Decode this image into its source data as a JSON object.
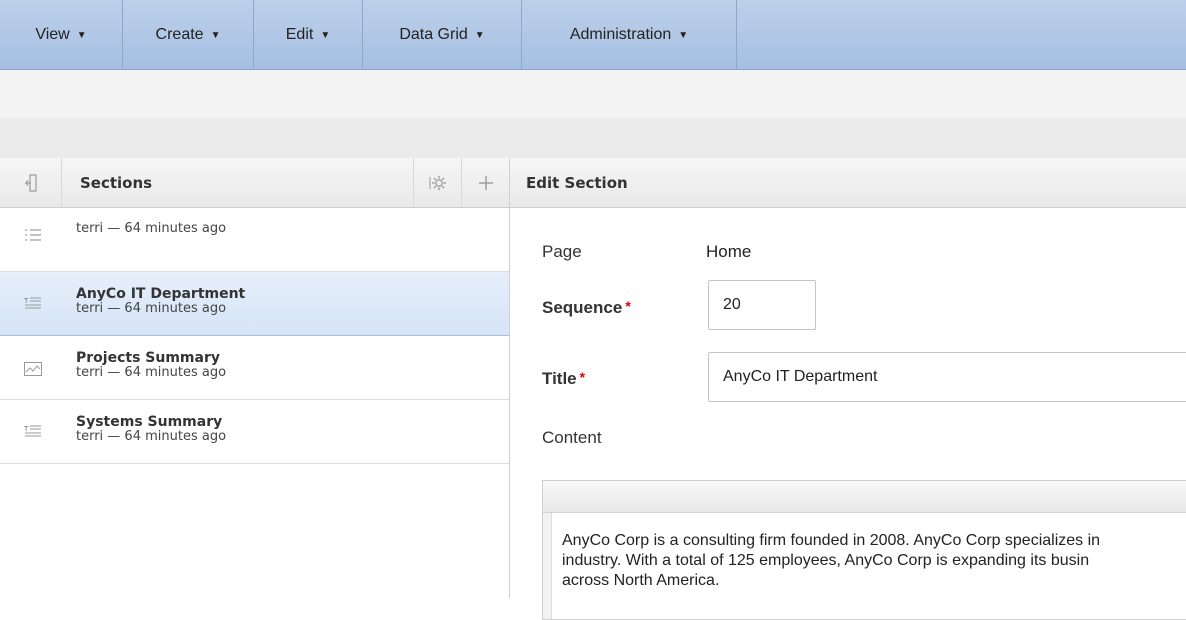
{
  "nav": {
    "items": [
      "View",
      "Create",
      "Edit",
      "Data Grid",
      "Administration"
    ],
    "caret": "▼"
  },
  "sections_panel": {
    "title": "Sections",
    "items": [
      {
        "name": "",
        "meta": "terri — 64 minutes ago",
        "icon": "list-icon"
      },
      {
        "name": "AnyCo IT Department",
        "meta": "terri — 64 minutes ago",
        "icon": "text-icon"
      },
      {
        "name": "Projects Summary",
        "meta": "terri — 64 minutes ago",
        "icon": "chart-icon"
      },
      {
        "name": "Systems Summary",
        "meta": "terri — 64 minutes ago",
        "icon": "text-icon"
      }
    ]
  },
  "edit_panel": {
    "title": "Edit Section",
    "page_label": "Page",
    "page_value": "Home",
    "sequence_label": "Sequence",
    "sequence_value": "20",
    "title_label": "Title",
    "title_value": "AnyCo IT Department",
    "required_marker": "*",
    "content_label": "Content",
    "content_lines": [
      "AnyCo Corp is a consulting firm founded in 2008. AnyCo Corp specializes in",
      "industry. With a total of 125 employees, AnyCo Corp is expanding its busin",
      "across North America."
    ]
  },
  "colors": {
    "nav_bg": "#a6bfe2",
    "selected_bg": "#d6e4f7",
    "required": "#e00000"
  }
}
